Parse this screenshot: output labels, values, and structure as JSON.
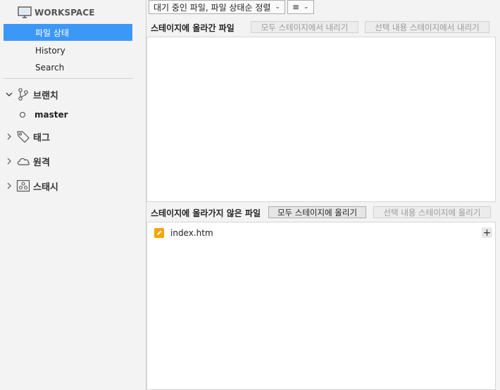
{
  "sidebar": {
    "workspace_label": "WORKSPACE",
    "nav_items": [
      {
        "label": "파일 상태"
      },
      {
        "label": "History"
      },
      {
        "label": "Search"
      }
    ],
    "sections": [
      {
        "label": "브랜치",
        "icon": "branch-icon",
        "expanded": true
      },
      {
        "label": "태그",
        "icon": "tag-icon",
        "expanded": false
      },
      {
        "label": "원격",
        "icon": "cloud-icon",
        "expanded": false
      },
      {
        "label": "스태시",
        "icon": "stash-icon",
        "expanded": false
      }
    ],
    "branch": {
      "name": "master"
    }
  },
  "toolbar": {
    "sort_label": "대기 중인 파일, 파일 상태순 정렬",
    "view_label": "≡"
  },
  "staged": {
    "title": "스테이지에 올라간 파일",
    "unstage_all_label": "모두 스테이지에서 내리기",
    "unstage_selected_label": "선택 내용 스테이지에서 내리기",
    "files": []
  },
  "unstaged": {
    "title": "스테이지에 올라가지 않은 파일",
    "stage_all_label": "모두 스테이지에 올리기",
    "stage_selected_label": "선택 내용 스테이지에 올리기",
    "files": [
      {
        "name": "index.htm",
        "status": "modified"
      }
    ]
  },
  "colors": {
    "selection": "#3c98f7",
    "modified": "#f3a500"
  }
}
